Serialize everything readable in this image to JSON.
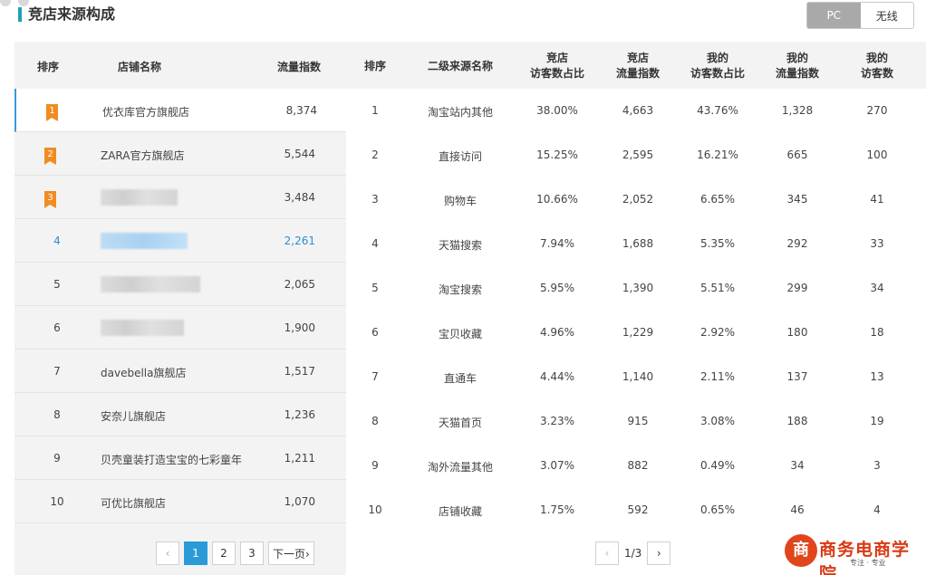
{
  "header": {
    "title": "竞店来源构成",
    "toggle": [
      {
        "label": "PC",
        "active": true
      },
      {
        "label": "无线",
        "active": false
      }
    ]
  },
  "left_table": {
    "headers": {
      "rank": "排序",
      "name": "店铺名称",
      "value": "流量指数"
    },
    "rows": [
      {
        "rank": "1",
        "name": "优衣库官方旗舰店",
        "value": "8,374"
      },
      {
        "rank": "2",
        "name": "ZARA官方旗舰店",
        "value": "5,544"
      },
      {
        "rank": "3",
        "name": "",
        "value": "3,484"
      },
      {
        "rank": "4",
        "name": "",
        "value": "2,261"
      },
      {
        "rank": "5",
        "name": "",
        "value": "2,065"
      },
      {
        "rank": "6",
        "name": "",
        "value": "1,900"
      },
      {
        "rank": "7",
        "name": "davebella旗舰店",
        "value": "1,517"
      },
      {
        "rank": "8",
        "name": "安奈儿旗舰店",
        "value": "1,236"
      },
      {
        "rank": "9",
        "name": "贝壳童装打造宝宝的七彩童年",
        "value": "1,211"
      },
      {
        "rank": "10",
        "name": "可优比旗舰店",
        "value": "1,070"
      }
    ],
    "pagination": {
      "prev": "‹",
      "pages": [
        "1",
        "2",
        "3"
      ],
      "next": "下一页›"
    }
  },
  "right_table": {
    "headers": [
      {
        "line1": "排序",
        "line2": ""
      },
      {
        "line1": "二级来源名称",
        "line2": ""
      },
      {
        "line1": "竞店",
        "line2": "访客数占比"
      },
      {
        "line1": "竞店",
        "line2": "流量指数"
      },
      {
        "line1": "我的",
        "line2": "访客数占比"
      },
      {
        "line1": "我的",
        "line2": "流量指数"
      },
      {
        "line1": "我的",
        "line2": "访客数"
      }
    ],
    "rows": [
      [
        "1",
        "淘宝站内其他",
        "38.00%",
        "4,663",
        "43.76%",
        "1,328",
        "270"
      ],
      [
        "2",
        "直接访问",
        "15.25%",
        "2,595",
        "16.21%",
        "665",
        "100"
      ],
      [
        "3",
        "购物车",
        "10.66%",
        "2,052",
        "6.65%",
        "345",
        "41"
      ],
      [
        "4",
        "天猫搜索",
        "7.94%",
        "1,688",
        "5.35%",
        "292",
        "33"
      ],
      [
        "5",
        "淘宝搜索",
        "5.95%",
        "1,390",
        "5.51%",
        "299",
        "34"
      ],
      [
        "6",
        "宝贝收藏",
        "4.96%",
        "1,229",
        "2.92%",
        "180",
        "18"
      ],
      [
        "7",
        "直通车",
        "4.44%",
        "1,140",
        "2.11%",
        "137",
        "13"
      ],
      [
        "8",
        "天猫首页",
        "3.23%",
        "915",
        "3.08%",
        "188",
        "19"
      ],
      [
        "9",
        "淘外流量其他",
        "3.07%",
        "882",
        "0.49%",
        "34",
        "3"
      ],
      [
        "10",
        "店铺收藏",
        "1.75%",
        "592",
        "0.65%",
        "46",
        "4"
      ]
    ],
    "pagination": {
      "prev": "‹",
      "text": "1/3",
      "next": "›"
    }
  },
  "watermark": {
    "name": "商务电商学院",
    "tagline": "专注 · 专业"
  },
  "colors": {
    "accent": "#2a9bd8",
    "medal": "#f08c20",
    "title_bar": "#1aa3b5"
  }
}
